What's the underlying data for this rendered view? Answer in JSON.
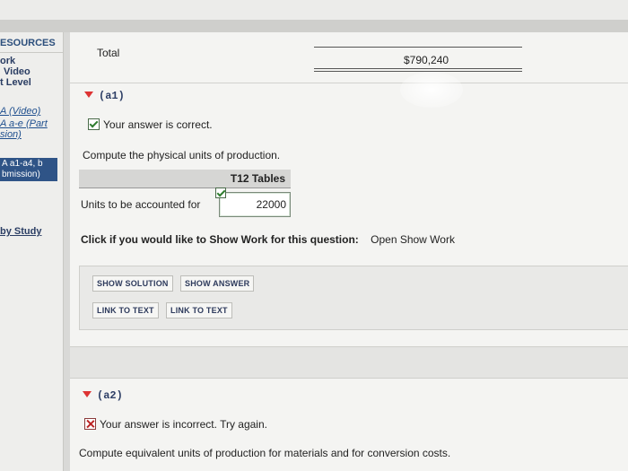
{
  "sidebar": {
    "header": "ESOURCES",
    "items": [
      {
        "label": "ork"
      },
      {
        "label": "Video"
      },
      {
        "label": "t Level"
      },
      {
        "label": "A (Video)"
      },
      {
        "label": "A a-e (Part"
      },
      {
        "label": "sion)"
      }
    ],
    "selected_line1": "A a1-a4, b",
    "selected_line2": "bmission)",
    "study_link": "by Study"
  },
  "total": {
    "label": "Total",
    "value": "$790,240"
  },
  "part_a1": {
    "title": "(a1)",
    "status": "Your answer is correct.",
    "prompt": "Compute the physical units of production.",
    "tables_label": "T12 Tables",
    "units_label": "Units to be accounted for",
    "units_value": "22000"
  },
  "show_work": {
    "question": "Click if you would like to Show Work for this question:",
    "link": "Open Show Work"
  },
  "buttons": {
    "show_solution": "SHOW SOLUTION",
    "show_answer": "SHOW ANSWER",
    "link_to_text_1": "LINK TO TEXT",
    "link_to_text_2": "LINK TO TEXT"
  },
  "part_a2": {
    "title": "(a2)",
    "status": "Your answer is incorrect.  Try again.",
    "prompt": "Compute equivalent units of production for materials and for conversion costs."
  }
}
